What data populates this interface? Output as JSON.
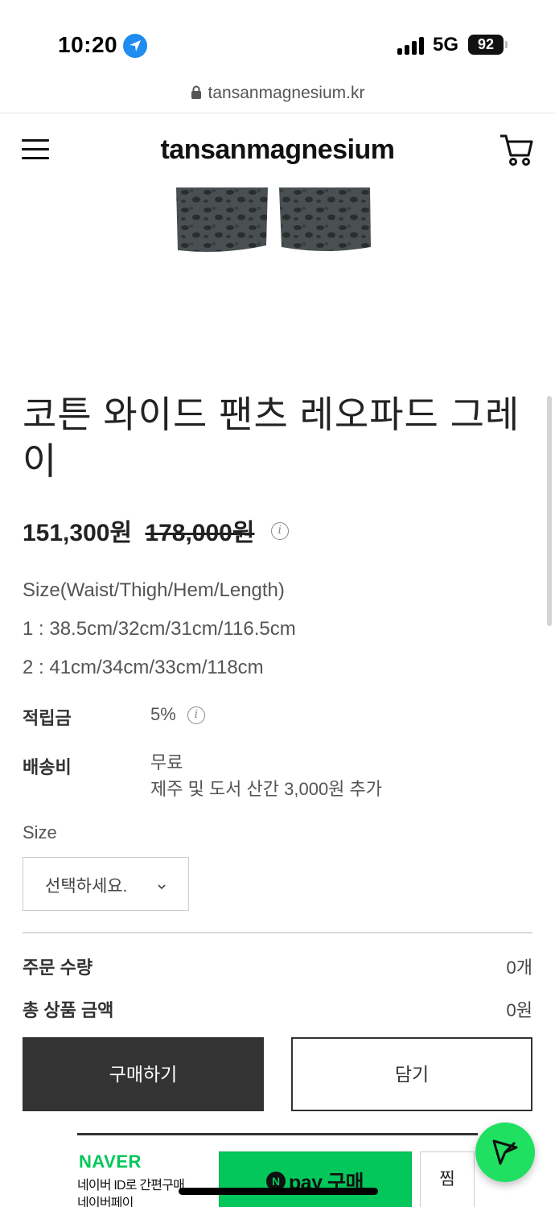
{
  "status_bar": {
    "time": "10:20",
    "network": "5G",
    "battery": "92"
  },
  "browser": {
    "url": "tansanmagnesium.kr"
  },
  "header": {
    "logo": "tansanmagnesium",
    "icons": [
      "menu-icon",
      "cart-icon"
    ]
  },
  "product": {
    "title": "코튼 와이드 팬츠 레오파드 그레이",
    "price": "151,300원",
    "original_price": "178,000원",
    "description": [
      "Size(Waist/Thigh/Hem/Length)",
      "1 : 38.5cm/32cm/31cm/116.5cm",
      "2 : 41cm/34cm/33cm/118cm"
    ],
    "meta": {
      "points_label": "적립금",
      "points_value": "5%",
      "shipping_label": "배송비",
      "shipping_value": "무료",
      "shipping_note": "제주 및 도서 산간 3,000원 추가"
    },
    "option": {
      "label": "Size",
      "selected": "선택하세요."
    }
  },
  "summary": {
    "quantity_label": "주문 수량",
    "quantity_value": "0개",
    "total_label": "총 상품 금액",
    "total_value": "0원"
  },
  "actions": {
    "buy": "구매하기",
    "add_to_cart": "담기"
  },
  "naver_pay": {
    "brand": "NAVER",
    "line1": "네이버 ID로 간편구매",
    "line2": "네이버페이",
    "button_n": "N",
    "button_label": "pay 구매",
    "wishlist": "찜"
  },
  "colors": {
    "naver_green": "#03c75a",
    "fab_green": "#1fe060",
    "buy_button": "#333333"
  }
}
